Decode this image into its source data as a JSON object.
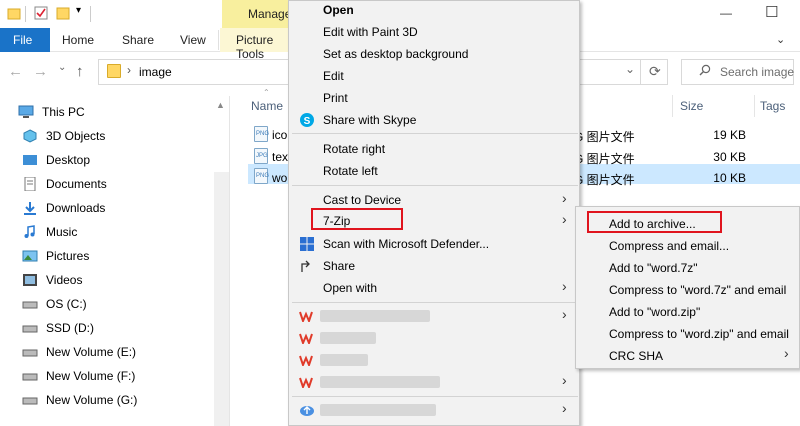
{
  "titlebar": {
    "manage_tab": "Manage",
    "minimize_glyph": "—",
    "maximize_glyph": "☐"
  },
  "ribbon": {
    "tabs": [
      "File",
      "Home",
      "Share",
      "View",
      "Picture Tools"
    ]
  },
  "address": {
    "back": "←",
    "forward": "→",
    "up": "↑",
    "path": "image",
    "refresh": "⟳",
    "search_placeholder": "Search image"
  },
  "sidebar": {
    "items": [
      {
        "label": "This PC",
        "icon": "computer-icon"
      },
      {
        "label": "3D Objects",
        "icon": "cube-icon"
      },
      {
        "label": "Desktop",
        "icon": "desktop-icon"
      },
      {
        "label": "Documents",
        "icon": "documents-icon"
      },
      {
        "label": "Downloads",
        "icon": "download-icon"
      },
      {
        "label": "Music",
        "icon": "music-icon"
      },
      {
        "label": "Pictures",
        "icon": "pictures-icon"
      },
      {
        "label": "Videos",
        "icon": "videos-icon"
      },
      {
        "label": "OS (C:)",
        "icon": "drive-icon"
      },
      {
        "label": "SSD (D:)",
        "icon": "drive-icon"
      },
      {
        "label": "New Volume (E:)",
        "icon": "drive-icon"
      },
      {
        "label": "New Volume (F:)",
        "icon": "drive-icon"
      },
      {
        "label": "New Volume (G:)",
        "icon": "drive-icon"
      }
    ]
  },
  "filelist": {
    "columns": {
      "name": "Name",
      "size": "Size",
      "tags": "Tags"
    },
    "rows": [
      {
        "name": "ico",
        "badge": "PNG",
        "type": "G 图片文件",
        "size": "19 KB"
      },
      {
        "name": "tex",
        "badge": "JPG",
        "type": "G 图片文件",
        "size": "30 KB"
      },
      {
        "name": "wo",
        "badge": "PNG",
        "type": "G 图片文件",
        "size": "10 KB"
      }
    ]
  },
  "context_menu": {
    "open": "Open",
    "edit_paint3d": "Edit with Paint 3D",
    "set_background": "Set as desktop background",
    "edit": "Edit",
    "print": "Print",
    "share_skype": "Share with Skype",
    "rotate_right": "Rotate right",
    "rotate_left": "Rotate left",
    "cast": "Cast to Device",
    "zip": "7-Zip",
    "defender": "Scan with Microsoft Defender...",
    "share": "Share",
    "open_with": "Open with",
    "submenu_arrow": "›"
  },
  "submenu": {
    "items": [
      "Add to archive...",
      "Compress and email...",
      "Add to \"word.7z\"",
      "Compress to \"word.7z\" and email",
      "Add to \"word.zip\"",
      "Compress to \"word.zip\" and email",
      "CRC SHA"
    ]
  },
  "colors": {
    "file_tab": "#1a73c8",
    "manage_tab": "#f8ef9e",
    "highlight_box": "#e0141e",
    "selection": "#cce8ff"
  }
}
